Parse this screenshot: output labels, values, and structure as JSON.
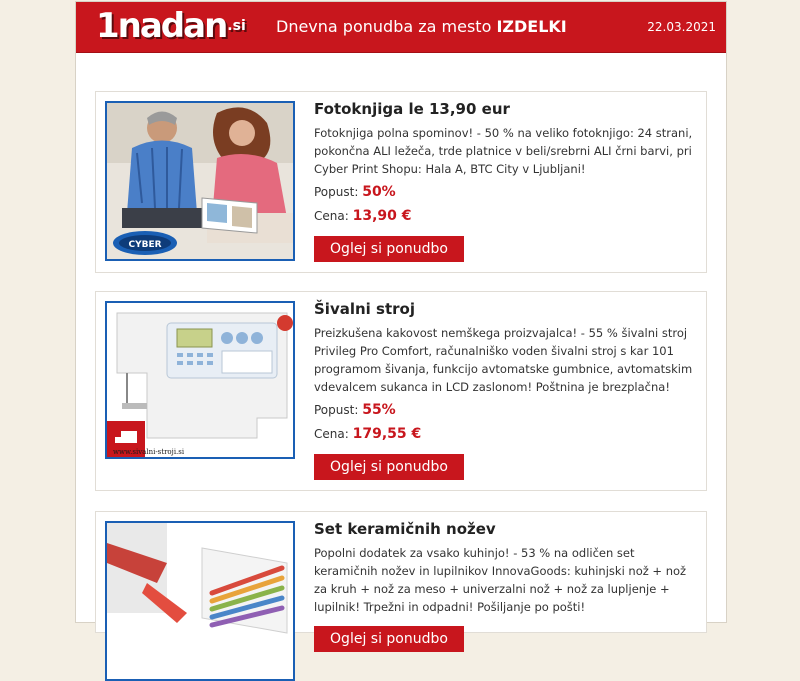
{
  "header": {
    "logo_main": "1nadan",
    "logo_tld": ".si",
    "title_prefix": "Dnevna ponudba za mesto ",
    "title_city": "IZDELKI",
    "date": "22.03.2021"
  },
  "offers": [
    {
      "title": "Fotoknjiga le 13,90 eur",
      "description": "Fotoknjiga polna spominov! - 50 % na veliko fotoknjigo: 24 strani, pokončna ALI ležeča, trde platnice v beli/srebrni ALI črni barvi, pri Cyber Print Shopu: Hala A, BTC City v Ljubljani!",
      "discount_label": "Popust:",
      "discount": "50%",
      "price_label": "Cena:",
      "price": "13,90 €",
      "button": "Oglej si ponudbo",
      "image_badge": "CYBER"
    },
    {
      "title": "Šivalni stroj",
      "description": "Preizkušena kakovost nemškega proizvajalca! - 55 % šivalni stroj Privileg Pro Comfort, računalniško voden šivalni stroj s kar 101 programom šivanja, funkcijo avtomatske gumbnice, avtomatskim vdevalcem sukanca in LCD zaslonom! Poštnina je brezplačna!",
      "discount_label": "Popust:",
      "discount": "55%",
      "price_label": "Cena:",
      "price": "179,55 €",
      "button": "Oglej si ponudbo",
      "image_caption": "www.sivalni-stroji.si"
    },
    {
      "title": "Set keramičnih nožev",
      "description": "Popolni dodatek za vsako kuhinjo! - 53 % na odličen set keramičnih nožev in lupilnikov InnovaGoods: kuhinjski nož + nož za kruh + nož za meso + univerzalni nož + nož za lupljenje + lupilnik! Trpežni in odpadni! Pošiljanje po pošti!",
      "button": "Oglej si ponudbo"
    }
  ]
}
